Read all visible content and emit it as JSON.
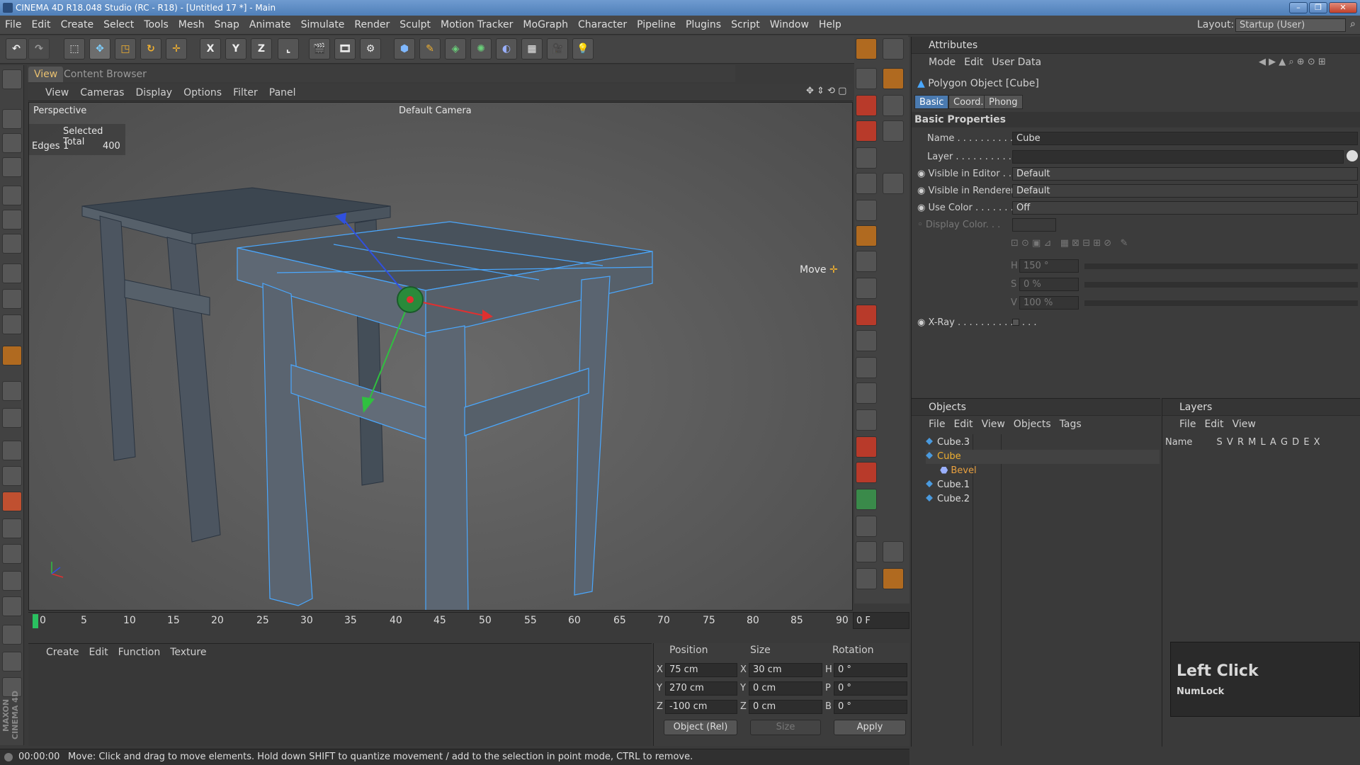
{
  "window": {
    "title": "CINEMA 4D R18.048 Studio (RC - R18) - [Untitled 17 *] - Main"
  },
  "menu": [
    "File",
    "Edit",
    "Create",
    "Select",
    "Tools",
    "Mesh",
    "Snap",
    "Animate",
    "Simulate",
    "Render",
    "Sculpt",
    "Motion Tracker",
    "MoGraph",
    "Character",
    "Pipeline",
    "Plugins",
    "Script",
    "Window",
    "Help"
  ],
  "layout": {
    "label": "Layout:",
    "value": "Startup (User)"
  },
  "toolbar": {
    "x_label": "X",
    "y_label": "Y",
    "z_label": "Z"
  },
  "view_tabs": {
    "view": "View",
    "content_browser": "Content Browser"
  },
  "view_menu": [
    "View",
    "Cameras",
    "Display",
    "Options",
    "Filter",
    "Panel"
  ],
  "viewport": {
    "projection": "Perspective",
    "camera": "Default Camera",
    "stats_header": "Selected Total",
    "stats_label": "Edges",
    "stats_selected": "1",
    "stats_total": "400",
    "move_label": "Move"
  },
  "timeline": {
    "ticks": [
      "0",
      "5",
      "10",
      "15",
      "20",
      "25",
      "30",
      "35",
      "40",
      "45",
      "50",
      "55",
      "60",
      "65",
      "70",
      "75",
      "80",
      "85",
      "90"
    ],
    "frame": "0 F"
  },
  "material_menu": [
    "Create",
    "Edit",
    "Function",
    "Texture"
  ],
  "coords": {
    "position_header": "Position",
    "size_header": "Size",
    "rotation_header": "Rotation",
    "px": "75 cm",
    "py": "270 cm",
    "pz": "-100 cm",
    "sx": "30 cm",
    "sy": "0 cm",
    "sz": "0 cm",
    "rh": "0 °",
    "rp": "0 °",
    "rb": "0 °",
    "axis_x": "X",
    "axis_y": "Y",
    "axis_z": "Z",
    "rot_h": "H",
    "rot_p": "P",
    "rot_b": "B",
    "mode": "Object (Rel)",
    "size_mode": "Size",
    "apply": "Apply"
  },
  "attributes": {
    "title": "Attributes",
    "menu": [
      "Mode",
      "Edit",
      "User Data"
    ],
    "object_title": "Polygon Object [Cube]",
    "tabs": [
      "Basic",
      "Coord.",
      "Phong"
    ],
    "section": "Basic Properties",
    "name_label": "Name . . . . . . . . . . . . . .",
    "name_value": "Cube",
    "layer_label": "Layer . . . . . . . . . . . . . .",
    "vis_editor_label": "Visible in Editor . . .",
    "vis_editor_value": "Default",
    "vis_render_label": "Visible in Renderer",
    "vis_render_value": "Default",
    "use_color_label": "Use Color . . . . . . . . . .",
    "use_color_value": "Off",
    "display_color_label": "Display Color. . .",
    "h_label": "H",
    "h_value": "150 °",
    "s_label": "S",
    "s_value": "0 %",
    "v_label": "V",
    "v_value": "100 %",
    "xray_label": "X-Ray . . . . . . . . . . . . . ."
  },
  "objects": {
    "title": "Objects",
    "menu": [
      "File",
      "Edit",
      "View",
      "Objects",
      "Tags"
    ],
    "items": [
      {
        "name": "Cube.3"
      },
      {
        "name": "Cube"
      },
      {
        "name": "Bevel"
      },
      {
        "name": "Cube.1"
      },
      {
        "name": "Cube.2"
      }
    ]
  },
  "layers": {
    "title": "Layers",
    "menu": [
      "File",
      "Edit",
      "View"
    ],
    "name_col": "Name",
    "cols": [
      "S",
      "V",
      "R",
      "M",
      "L",
      "A",
      "G",
      "D",
      "E",
      "X"
    ]
  },
  "popup": {
    "title": "Left Click",
    "sub": "NumLock"
  },
  "status": {
    "time": "00:00:00",
    "message": "Move: Click and drag to move elements. Hold down SHIFT to quantize movement / add to the selection in point mode, CTRL to remove."
  },
  "colors": {
    "accent": "#e8c070",
    "selection": "#4aa8ff",
    "active_tab": "#4a7ab0"
  }
}
